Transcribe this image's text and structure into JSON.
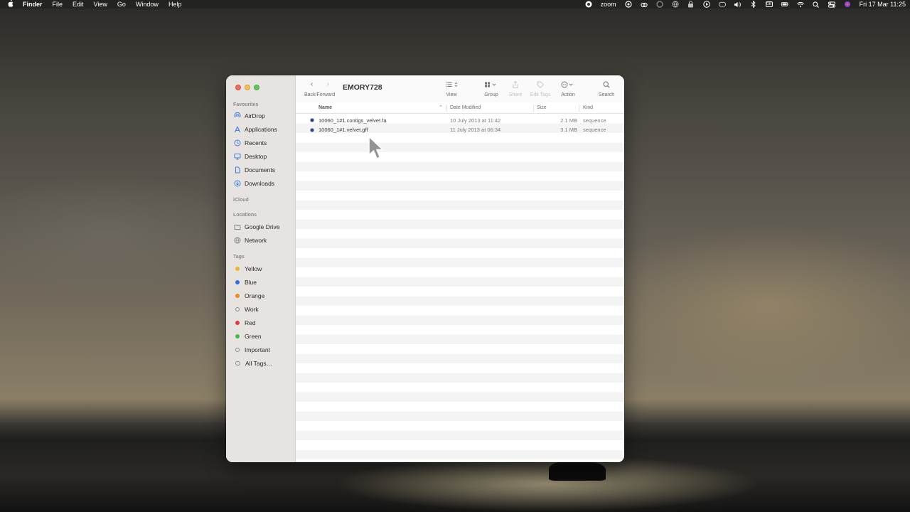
{
  "menubar": {
    "app": "Finder",
    "items": [
      "File",
      "Edit",
      "View",
      "Go",
      "Window",
      "Help"
    ],
    "zoom_label": "zoom",
    "battery_badge": "GB",
    "clock": "Fri 17 Mar  11:25"
  },
  "window": {
    "title": "EMORY728",
    "nav_label": "Back/Forward",
    "tools": {
      "view": "View",
      "group": "Group",
      "share": "Share",
      "edit_tags": "Edit Tags",
      "action": "Action",
      "search": "Search"
    }
  },
  "sidebar": {
    "favourites_header": "Favourites",
    "favourites": [
      {
        "label": "AirDrop",
        "icon": "airdrop-icon"
      },
      {
        "label": "Applications",
        "icon": "applications-icon"
      },
      {
        "label": "Recents",
        "icon": "clock-icon"
      },
      {
        "label": "Desktop",
        "icon": "desktop-icon"
      },
      {
        "label": "Documents",
        "icon": "document-icon"
      },
      {
        "label": "Downloads",
        "icon": "download-icon"
      }
    ],
    "icloud_header": "iCloud",
    "locations_header": "Locations",
    "locations": [
      {
        "label": "Google Drive",
        "icon": "folder-icon"
      },
      {
        "label": "Network",
        "icon": "globe-icon"
      }
    ],
    "tags_header": "Tags",
    "tags": [
      {
        "label": "Yellow",
        "color": "#f0b429"
      },
      {
        "label": "Blue",
        "color": "#2f6fdf"
      },
      {
        "label": "Orange",
        "color": "#f08a1c"
      },
      {
        "label": "Work",
        "color": ""
      },
      {
        "label": "Red",
        "color": "#e23b3b"
      },
      {
        "label": "Green",
        "color": "#3fbf4a"
      },
      {
        "label": "Important",
        "color": ""
      },
      {
        "label": "All Tags…",
        "color": ""
      }
    ]
  },
  "columns": {
    "name": "Name",
    "date_modified": "Date Modified",
    "size": "Size",
    "kind": "Kind"
  },
  "files": [
    {
      "name": "10060_1#1.contigs_velvet.fa",
      "date": "10 July 2013 at 11:42",
      "size": "2.1 MB",
      "kind": "sequence"
    },
    {
      "name": "10060_1#1.velvet.gff",
      "date": "11 July 2013 at 06:34",
      "size": "3.1 MB",
      "kind": "sequence"
    }
  ]
}
